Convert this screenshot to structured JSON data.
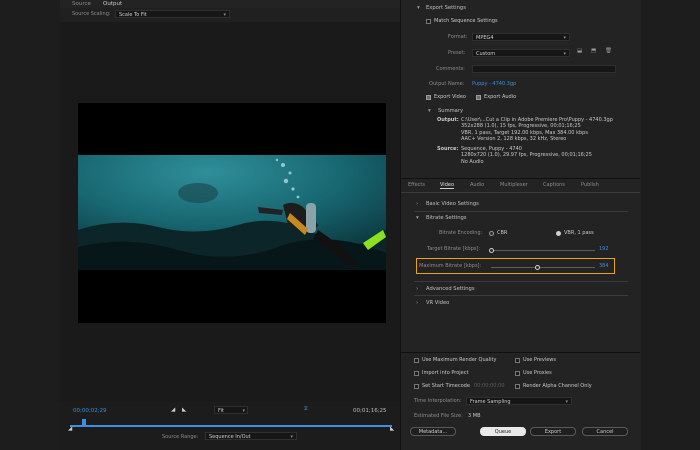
{
  "tabs": {
    "source": "Source",
    "output": "Output"
  },
  "source_scaling": {
    "label": "Source Scaling:",
    "value": "Scale To Fit"
  },
  "timeline": {
    "current_time": "00;00;02;29",
    "duration": "00;01;16;25",
    "fit": "Fit",
    "source_range_label": "Source Range:",
    "source_range_value": "Sequence In/Out"
  },
  "export": {
    "section_title": "Export Settings",
    "match_sequence": "Match Sequence Settings",
    "format_label": "Format:",
    "format_value": "MPEG4",
    "preset_label": "Preset:",
    "preset_value": "Custom",
    "comments_label": "Comments:",
    "comments_value": "",
    "output_name_label": "Output Name:",
    "output_name_value": "Puppy - 4740.3gp",
    "export_video": "Export Video",
    "export_audio": "Export Audio",
    "summary_title": "Summary",
    "output_label": "Output:",
    "output_lines": [
      "C:\\User\\...Cut a Clip in Adobe Premiere Pro\\Puppy - 4740.3gp",
      "352x288 (1.0), 15 fps, Progressive, 00;01;16;25",
      "VBR, 1 pass, Target 192.00 kbps, Max 384.00 kbps",
      "AAC+ Version 2, 128 kbps, 32 kHz, Stereo"
    ],
    "source_label": "Source:",
    "source_lines": [
      "Sequence, Puppy - 4740",
      "1280x720 (1.0), 29.97 fps, Progressive, 00;01;16;25",
      "No Audio"
    ]
  },
  "settings_tabs": [
    "Effects",
    "Video",
    "Audio",
    "Multiplexer",
    "Captions",
    "Publish"
  ],
  "video_settings": {
    "basic": "Basic Video Settings",
    "bitrate": "Bitrate Settings",
    "encoding_label": "Bitrate Encoding:",
    "cbr": "CBR",
    "vbr": "VBR, 1 pass",
    "target_label": "Target Bitrate [kbps]:",
    "target_value": "192",
    "target_fraction": 0.0,
    "max_label": "Maximum Bitrate [kbps]:",
    "max_value": "384",
    "max_fraction": 0.45,
    "advanced": "Advanced Settings",
    "vr": "VR Video"
  },
  "options": {
    "max_render": "Use Maximum Render Quality",
    "previews": "Use Previews",
    "import": "Import into Project",
    "proxies": "Use Proxies",
    "timecode": "Set Start Timecode",
    "timecode_value": "00;00;00;00",
    "alpha": "Render Alpha Channel Only",
    "interp_label": "Time Interpolation:",
    "interp_value": "Frame Sampling",
    "filesize_label": "Estimated File Size:",
    "filesize_value": "3 MB"
  },
  "buttons": {
    "metadata": "Metadata...",
    "queue": "Queue",
    "export": "Export",
    "cancel": "Cancel"
  },
  "colors": {
    "accent": "#3b8fe0",
    "highlight": "#e8a317",
    "background": "#1d1d1d"
  }
}
